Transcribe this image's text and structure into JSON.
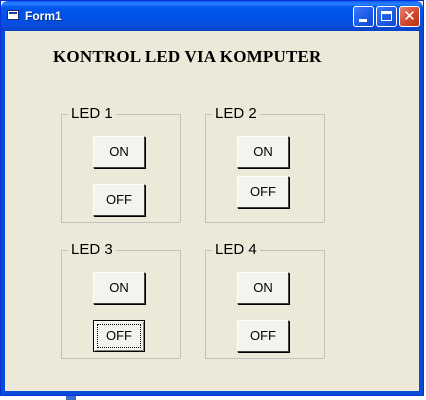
{
  "window": {
    "title": "Form1"
  },
  "titlebar_buttons": {
    "close_glyph": "✕"
  },
  "heading": "KONTROL LED VIA KOMPUTER",
  "groups": [
    {
      "label": "LED 1",
      "on_label": "ON",
      "off_label": "OFF"
    },
    {
      "label": "LED 2",
      "on_label": "ON",
      "off_label": "OFF"
    },
    {
      "label": "LED 3",
      "on_label": "ON",
      "off_label": "OFF"
    },
    {
      "label": "LED 4",
      "on_label": "ON",
      "off_label": "OFF"
    }
  ],
  "colors": {
    "titlebar": "#0058ee",
    "window_background": "#ece9d8",
    "close_button": "#d24a2d"
  },
  "icons": [
    "app-icon",
    "minimize-icon",
    "maximize-icon",
    "close-icon"
  ]
}
